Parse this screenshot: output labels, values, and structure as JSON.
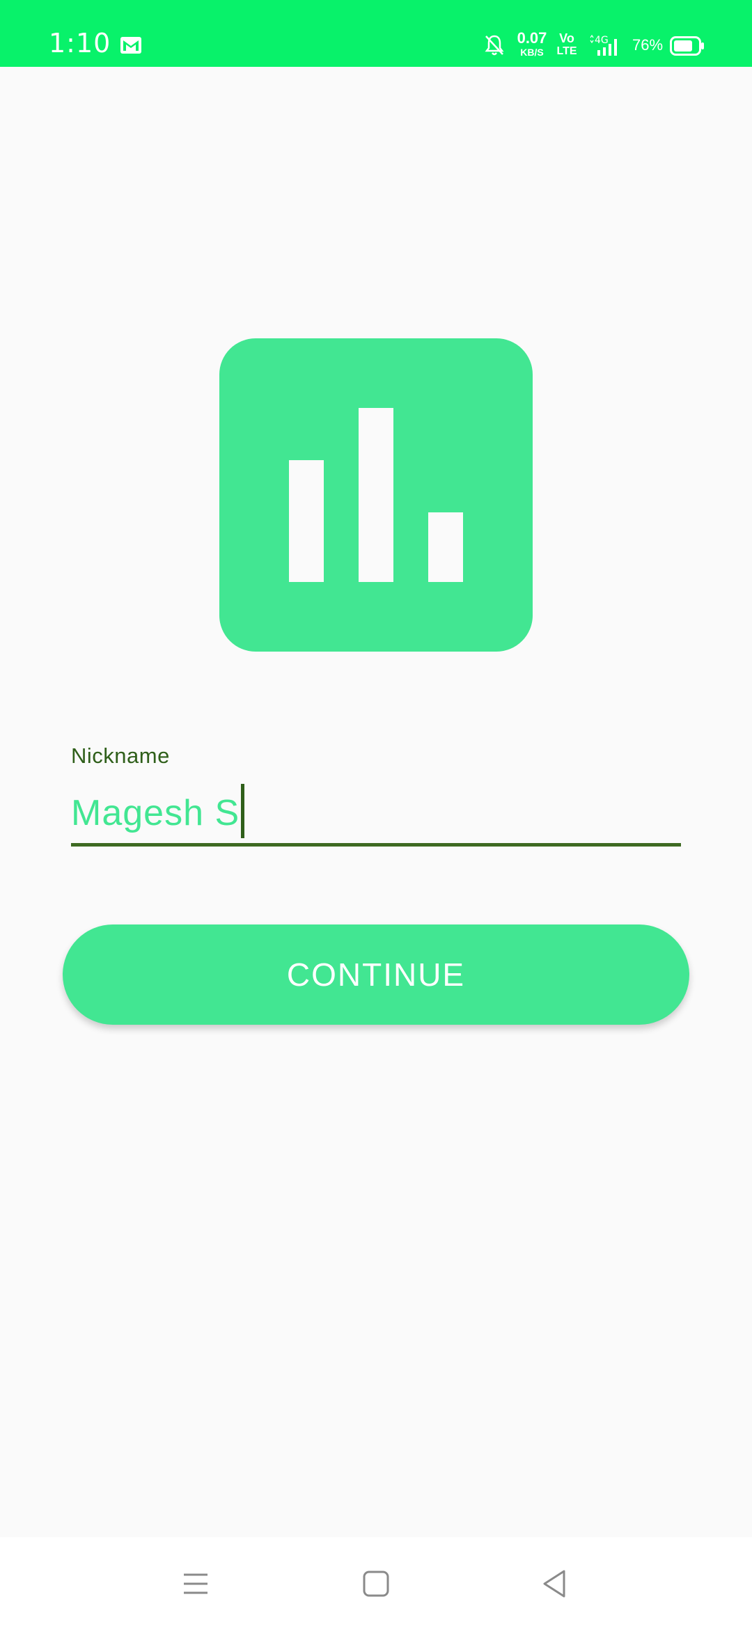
{
  "status_bar": {
    "time": "1:10",
    "net_speed_value": "0.07",
    "net_speed_unit": "KB/S",
    "volte_top": "Vo",
    "volte_bottom": "LTE",
    "network_type": "4G",
    "battery_percent": "76%",
    "icons": [
      "gmail-icon",
      "bell-off-icon",
      "signal-4g-icon",
      "battery-icon"
    ]
  },
  "logo": {
    "icon": "bar-chart-icon",
    "background_color": "#42E692"
  },
  "form": {
    "nickname_label": "Nickname",
    "nickname_value": "Magesh S",
    "continue_label": "CONTINUE"
  },
  "navigation": {
    "icons": [
      "menu-icon",
      "home-square-icon",
      "back-triangle-icon"
    ]
  },
  "colors": {
    "status_bar": "#08F26A",
    "accent": "#42E692",
    "label_dark_green": "#2F5F1A",
    "background": "#FAFAFA"
  }
}
